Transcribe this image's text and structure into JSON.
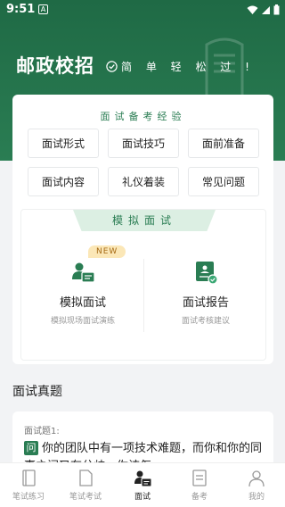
{
  "status_bar": {
    "time": "9:51",
    "notif_label": "A"
  },
  "header": {
    "brand": "邮政校招",
    "slogan": "简 单 轻 松 过 !"
  },
  "experience": {
    "title": "面试备考经验",
    "topics": [
      "面试形式",
      "面试技巧",
      "面前准备",
      "面试内容",
      "礼仪着装",
      "常见问题"
    ]
  },
  "mock": {
    "tab_title": "模拟面试",
    "left": {
      "badge": "NEW",
      "label": "模拟面试",
      "sub": "模拟现场面试演练",
      "icon": "interviewer-icon"
    },
    "right": {
      "label": "面试报告",
      "sub": "面试考核建议",
      "icon": "report-icon"
    }
  },
  "real_questions": {
    "section_title": "面试真题",
    "item_label": "面试题1:",
    "badge": "问",
    "text": "你的团队中有一项技术难题，而你和你的同事之间又有分歧，你该怎"
  },
  "tabbar": [
    {
      "label": "笔试练习",
      "icon": "notebook-icon",
      "active": false
    },
    {
      "label": "笔试考试",
      "icon": "page-icon",
      "active": false
    },
    {
      "label": "面试",
      "icon": "interview-icon",
      "active": true
    },
    {
      "label": "备考",
      "icon": "checklist-icon",
      "active": false
    },
    {
      "label": "我的",
      "icon": "profile-icon",
      "active": false
    }
  ],
  "colors": {
    "brand_green": "#2a7d53",
    "badge_bg": "#fbe7b7"
  }
}
